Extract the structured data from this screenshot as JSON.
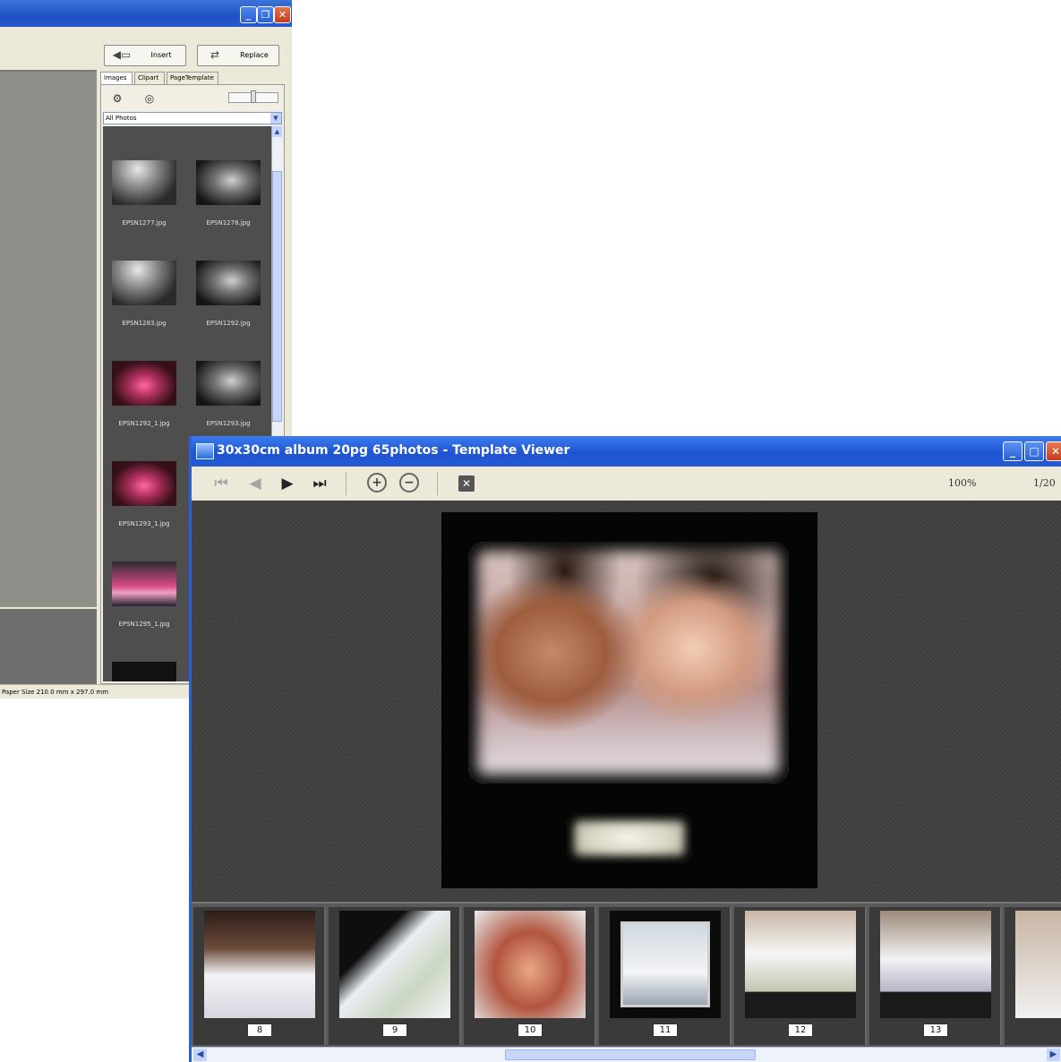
{
  "back_window": {
    "buttons": {
      "insert": "Insert",
      "replace": "Replace"
    },
    "tabs": [
      "Images",
      "Clipart",
      "PageTemplate"
    ],
    "album_filter": "All Photos",
    "thumbnails": [
      {
        "name": "EPSN1277.jpg"
      },
      {
        "name": "EPSN1278.jpg"
      },
      {
        "name": "EPSN1283.jpg"
      },
      {
        "name": "EPSN1292.jpg"
      },
      {
        "name": "EPSN1292_1.jpg"
      },
      {
        "name": "EPSN1293.jpg"
      },
      {
        "name": "EPSN1293_1.jpg"
      },
      {
        "name": "EPSN1295_1.jpg"
      }
    ],
    "status": "Paper Size  210.0 mm x 297.0 mm"
  },
  "template_viewer": {
    "title": "30x30cm album 20pg 65photos - Template Viewer",
    "zoom": "100%",
    "page_indicator": "1/20",
    "filmstrip_pages": [
      "8",
      "9",
      "10",
      "11",
      "12",
      "13"
    ]
  },
  "colors": {
    "titlebar_blue": "#1f51c4",
    "toolbar_beige": "#ece9d8",
    "viewer_bg": "#3c3c3c"
  }
}
